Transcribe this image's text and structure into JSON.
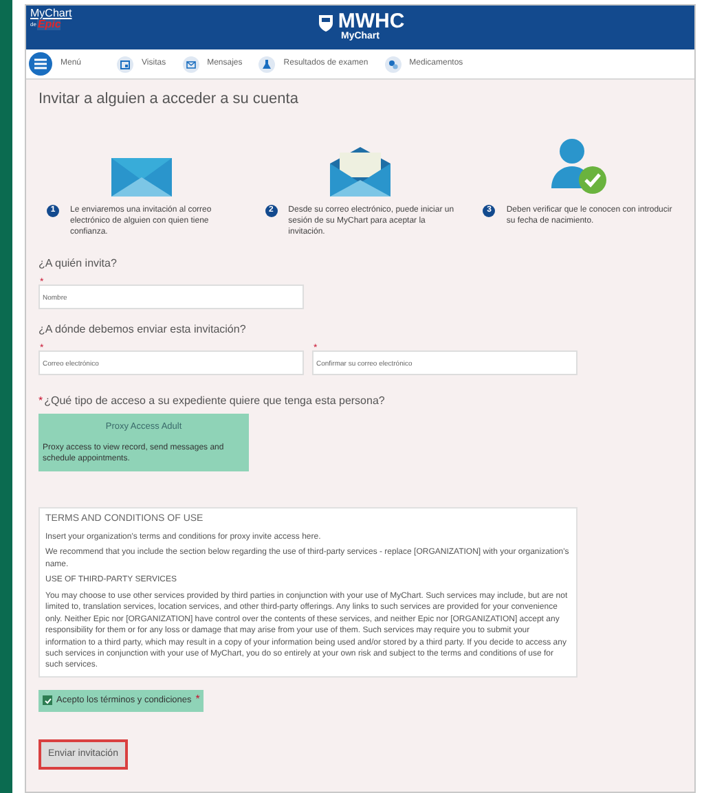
{
  "header": {
    "brand_top": "MyChart",
    "brand_by": "de",
    "brand_epic": "Epic",
    "title": "MWHC",
    "subtitle": "MyChart"
  },
  "nav": [
    {
      "kind": "menu",
      "label": "Menú"
    },
    {
      "kind": "calendar",
      "label": "Visitas"
    },
    {
      "kind": "mail",
      "label": "Mensajes"
    },
    {
      "kind": "flask",
      "label": "Resultados de examen"
    },
    {
      "kind": "pills",
      "label": "Medicamentos"
    }
  ],
  "page_title": "Invitar a alguien a acceder a su cuenta",
  "steps": [
    {
      "kind": "envelope",
      "number": "1",
      "text": "Le enviaremos una invitación al correo electrónico de alguien con quien tiene confianza."
    },
    {
      "kind": "open-envelope",
      "number": "2",
      "text": "Desde su correo electrónico, puede iniciar un sesión de su MyChart para aceptar la invitación."
    },
    {
      "kind": "person-check",
      "number": "3",
      "text": "Deben verificar que le conocen con introducir su fecha de nacimiento."
    }
  ],
  "who": {
    "heading": "¿A quién invita?",
    "fields": [
      {
        "placeholder": "Nombre",
        "required_mark": "*"
      }
    ]
  },
  "where": {
    "heading": "¿A dónde debemos enviar esta invitación?",
    "fields": [
      {
        "placeholder": "Correo electrónico",
        "required_mark": "*"
      },
      {
        "placeholder": "Confirmar su correo electrónico",
        "required_mark": "*"
      }
    ]
  },
  "access": {
    "heading": "¿Qué tipo de acceso a su expediente quiere que tenga esta persona?",
    "required_mark": "*",
    "options": [
      {
        "title": "Proxy Access Adult",
        "description": "Proxy access to view record, send messages and schedule appointments.",
        "selected": true
      }
    ]
  },
  "terms": {
    "paragraphs": [
      {
        "kind": "heading",
        "text": "TERMS AND CONDITIONS OF USE"
      },
      {
        "kind": "text",
        "text": "Insert your organization's terms and conditions for proxy invite access here."
      },
      {
        "kind": "text",
        "text": "We recommend that you include the section below regarding the use of third-party services - replace [ORGANIZATION] with your organization's name."
      },
      {
        "kind": "subheading",
        "text": "USE OF THIRD-PARTY SERVICES"
      },
      {
        "kind": "text",
        "text": "You may choose to use other services provided by third parties in conjunction with your use of MyChart. Such services may include, but are not limited to, translation services, location services, and other third-party offerings. Any links to such services are provided for your convenience only. Neither Epic nor [ORGANIZATION] have control over the contents of these services, and neither Epic nor [ORGANIZATION] accept any responsibility for them or for any loss or damage that may arise from your use of them. Such services may require you to submit your information to a third party, which may result in a copy of your information being used and/or stored by a third party. If you decide to access any such services in conjunction with your use of MyChart, you do so entirely at your own risk and subject to the terms and conditions of use for such services."
      }
    ]
  },
  "accept": {
    "label": "Acepto los términos y condiciones",
    "checked": true,
    "required_mark": "*"
  },
  "submit": {
    "label": "Enviar invitación"
  }
}
